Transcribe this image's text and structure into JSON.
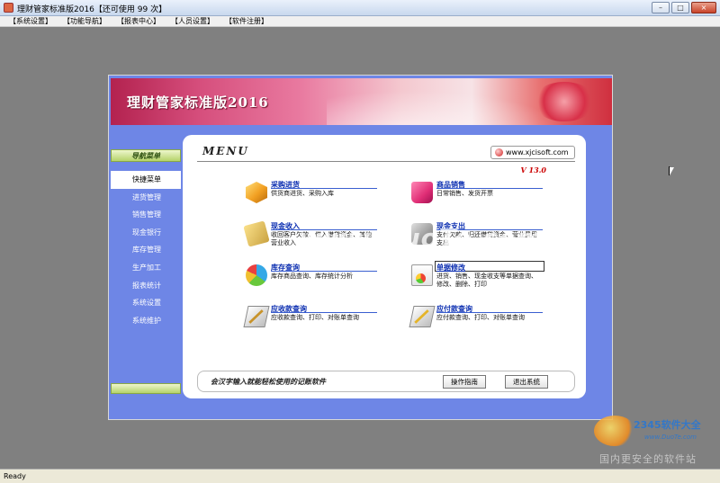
{
  "window": {
    "title": "理财管家标准版2016【还可使用 99 次】",
    "controls": {
      "minimize": "–",
      "maximize": "□",
      "close": "×"
    }
  },
  "menubar": {
    "items": [
      "【系统设置】",
      "【功能导航】",
      "【报表中心】",
      "【人员设置】",
      "【软件注册】"
    ]
  },
  "banner": {
    "title": "理财管家标准版2016"
  },
  "sidebar": {
    "header": "导航菜单",
    "items": [
      {
        "label": "快捷菜单",
        "active": true
      },
      {
        "label": "进货管理",
        "active": false
      },
      {
        "label": "销售管理",
        "active": false
      },
      {
        "label": "现金银行",
        "active": false
      },
      {
        "label": "库存管理",
        "active": false
      },
      {
        "label": "生产加工",
        "active": false
      },
      {
        "label": "报表统计",
        "active": false
      },
      {
        "label": "系统设置",
        "active": false
      },
      {
        "label": "系统维护",
        "active": false
      }
    ]
  },
  "panel": {
    "menu_title": "MENU",
    "url": "www.xjcisoft.com",
    "version": "V 13.0",
    "functions": [
      {
        "name": "采购进货",
        "desc": "供货商进货、采购入库",
        "icon": "cube-icon"
      },
      {
        "name": "商品销售",
        "desc": "日常销售、发货开票",
        "icon": "shopping-bag-icon"
      },
      {
        "name": "现金收入",
        "desc": "收回客户欠款、借入借贷资金、其他营业收入",
        "icon": "cash-in-icon"
      },
      {
        "name": "现金支出",
        "desc": "支付欠款、归还借贷资金、营业费用支出",
        "icon": "cash-out-icon"
      },
      {
        "name": "库存查询",
        "desc": "库存商品查询、库存统计分析",
        "icon": "pie-chart-icon"
      },
      {
        "name": "单据修改",
        "desc": "进货、销售、现金收支等单据查询、修改、删除、打印",
        "icon": "document-chart-icon"
      },
      {
        "name": "应收款查询",
        "desc": "应收款查询、打印、对账单查询",
        "icon": "receivable-pen-icon"
      },
      {
        "name": "应付款查询",
        "desc": "应付款查询、打印、对账单查询",
        "icon": "payable-pen-icon"
      }
    ],
    "slogan": "会汉字输入就能轻松使用的记账软件",
    "buttons": {
      "guide": "操作指南",
      "exit": "退出系统"
    }
  },
  "statusbar": {
    "text": "Ready"
  },
  "watermarks": {
    "center": "www.DuoTe.com",
    "corner_brand": "2345软件大全",
    "corner_url": "www.DuoTe.com",
    "corner_tagline": "国内更安全的软件站"
  }
}
